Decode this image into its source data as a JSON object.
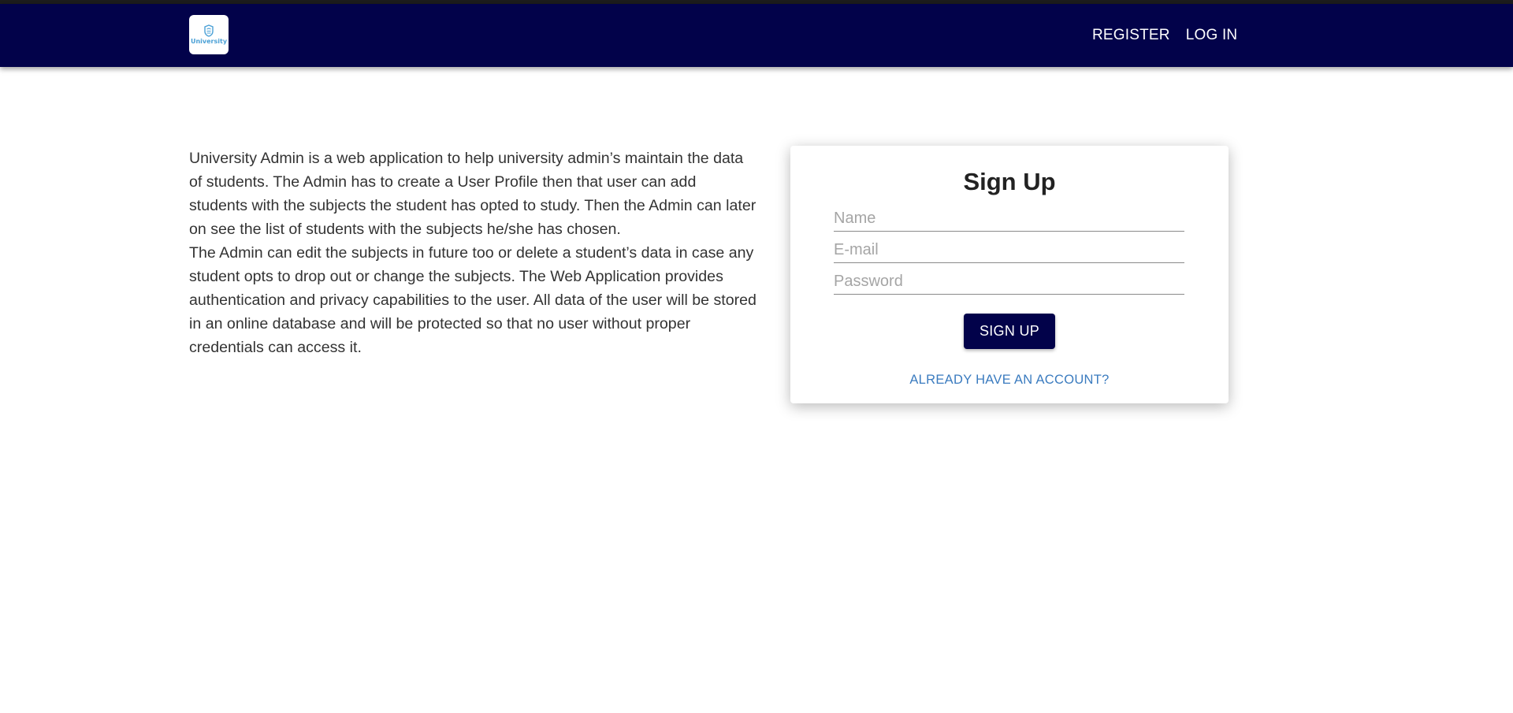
{
  "nav": {
    "logo_text": "University",
    "links": [
      {
        "label": "REGISTER"
      },
      {
        "label": "LOG IN"
      }
    ],
    "colors": {
      "bar": "#02024a",
      "text": "#ffffff"
    }
  },
  "intro": {
    "paragraph1": "University Admin is a web application to help university admin’s maintain the data of students. The Admin has to create a User Profile then that user can add students with the subjects the student has opted to study. Then the Admin can later on see the list of students with the subjects he/she has chosen.",
    "paragraph2": "The Admin can edit the subjects in future too or delete a student’s data in case any student opts to drop out or change the subjects. The Web Application provides authentication and privacy capabilities to the user. All data of the user will be stored in an online database and will be protected so that no user without proper credentials can access it."
  },
  "signup": {
    "title": "Sign Up",
    "name_placeholder": "Name",
    "email_placeholder": "E-mail",
    "password_placeholder": "Password",
    "button_label": "SIGN UP",
    "account_link": "ALREADY HAVE AN ACCOUNT?",
    "colors": {
      "button": "#02024a",
      "link": "#3a7bbf"
    }
  }
}
